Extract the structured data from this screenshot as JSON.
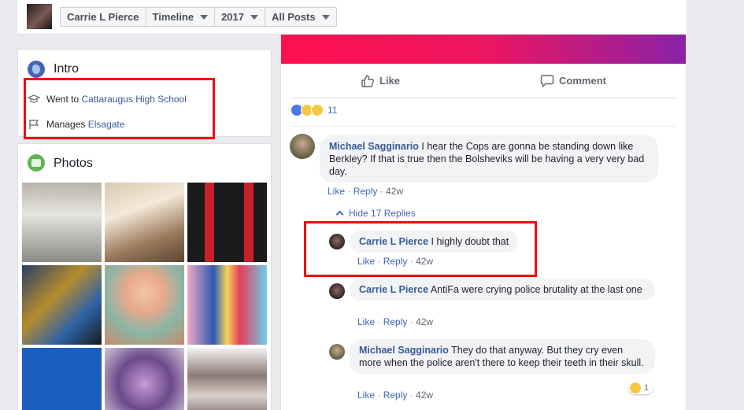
{
  "header": {
    "breadcrumbs": [
      "Carrie L Pierce",
      "Timeline",
      "2017",
      "All Posts"
    ]
  },
  "intro": {
    "title": "Intro",
    "education_prefix": "Went to",
    "education_link": "Cattaraugus High School",
    "manages_prefix": "Manages",
    "manages_link": "Elsagate"
  },
  "photos": {
    "title": "Photos"
  },
  "post": {
    "like_label": "Like",
    "comment_label": "Comment",
    "reaction_count": "11",
    "reply_label": "Reply",
    "hide_replies_label": "Hide 17 Replies",
    "comments": [
      {
        "author": "Michael Sagginario",
        "text": "I hear the Cops are gonna be standing down like Berkley? If that is true then the Bolsheviks will be having a very very bad day.",
        "like": "Like",
        "reply": "Reply",
        "time": "42w"
      },
      {
        "author": "Carrie L Pierce",
        "text": "I highly doubt that",
        "like": "Like",
        "reply": "Reply",
        "time": "42w"
      },
      {
        "author": "Carrie L Pierce",
        "text": "AntiFa were crying police brutality at the last one",
        "like": "Like",
        "reply": "Reply",
        "time": "42w"
      },
      {
        "author": "Michael Sagginario",
        "text": "They do that anyway. But they cry even more when the police aren't there to keep their teeth in their skull.",
        "like": "Like",
        "reply": "Reply",
        "time": "42w",
        "reaction_count": "1"
      }
    ]
  },
  "colors": {
    "link": "#385898",
    "highlight_box": "#f20d0d",
    "banner_start": "#ff0f4f",
    "banner_end": "#8a22a6"
  },
  "icons": [
    "globe-icon",
    "graduation-cap-icon",
    "flag-icon",
    "photos-icon",
    "like-thumb-icon",
    "comment-bubble-icon",
    "chevron-up-icon"
  ]
}
